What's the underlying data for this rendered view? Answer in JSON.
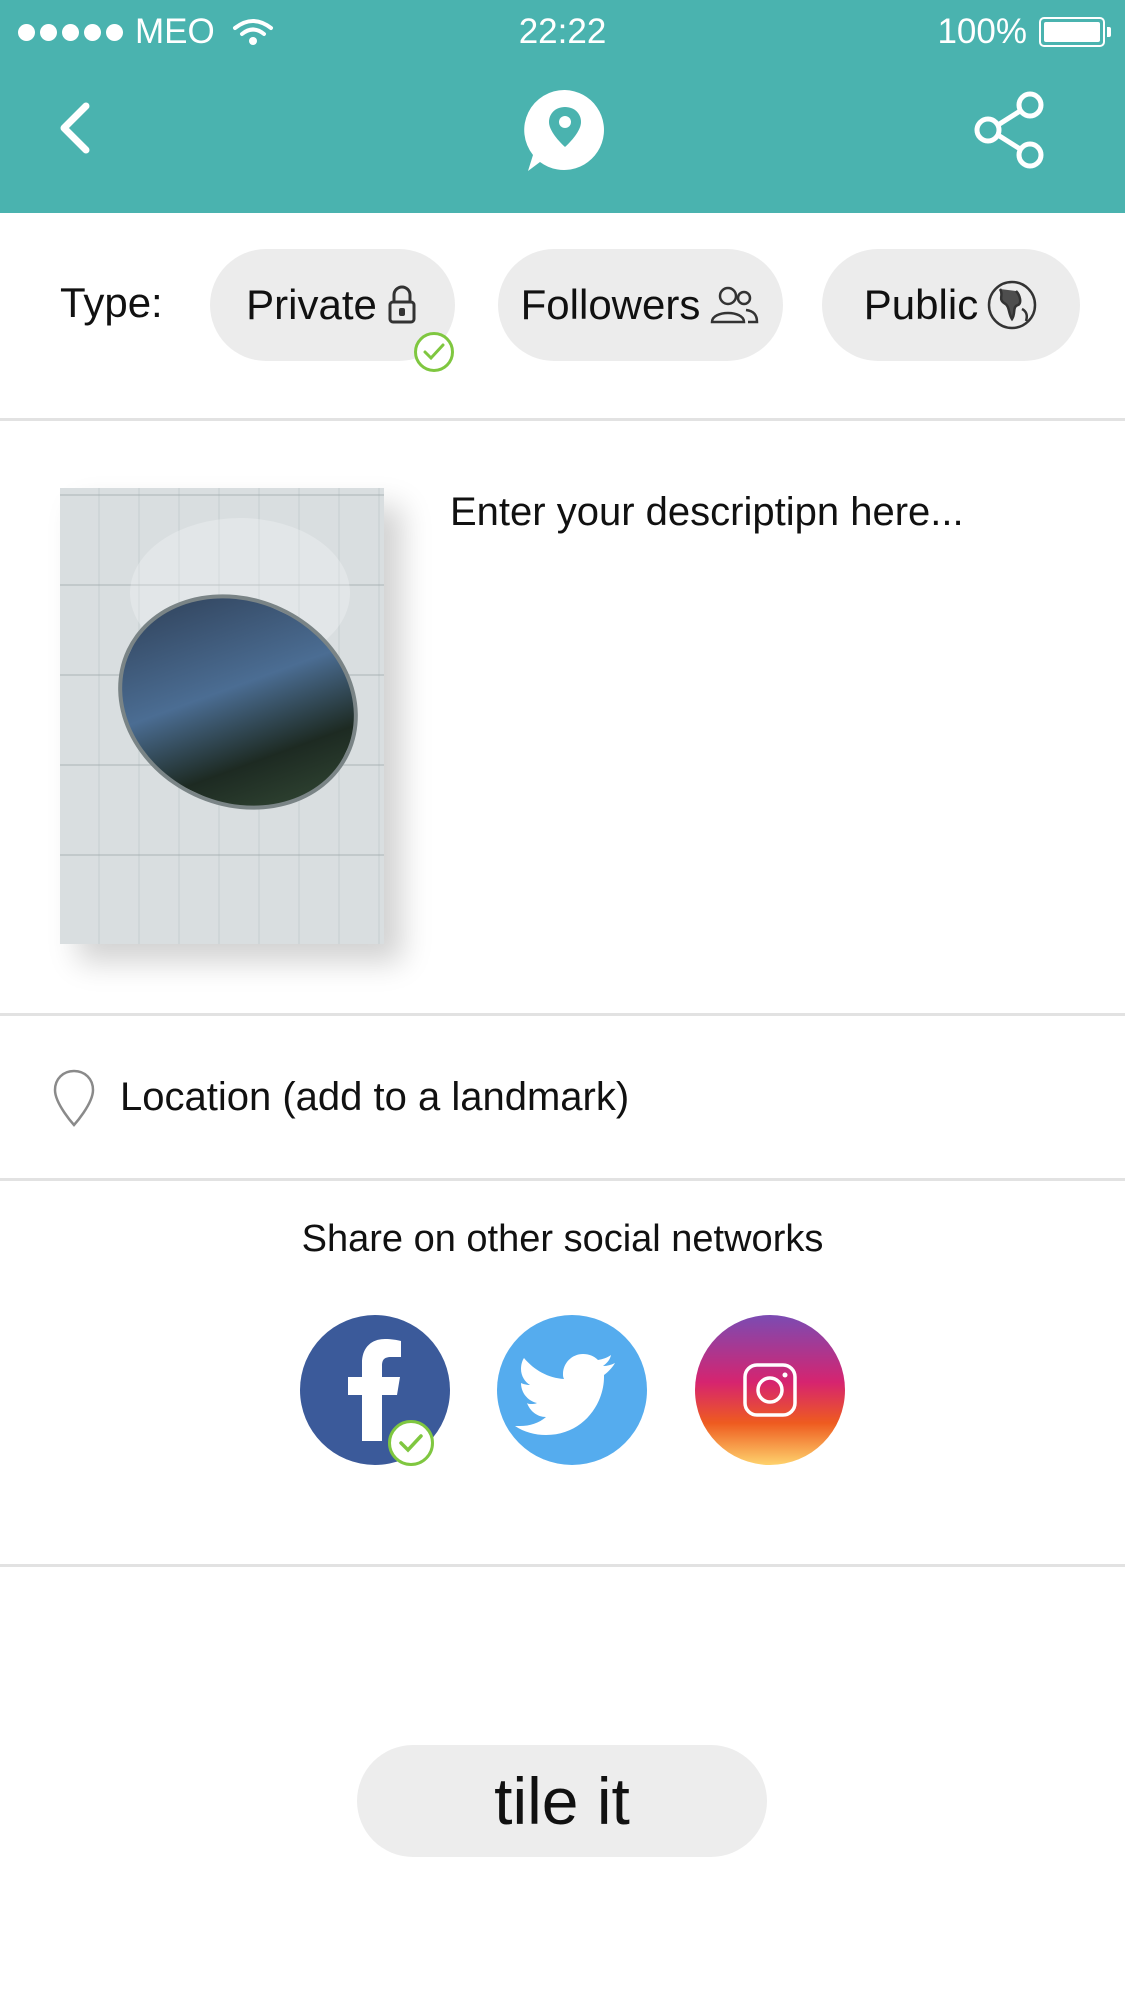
{
  "status_bar": {
    "carrier": "MEO",
    "time": "22:22",
    "battery": "100%"
  },
  "nav": {
    "back_icon": "chevron-left-icon",
    "logo_icon": "map-pin-bubble-icon",
    "share_icon": "share-icon"
  },
  "type": {
    "label": "Type:",
    "options": [
      {
        "label": "Private",
        "icon": "lock-icon",
        "selected": true
      },
      {
        "label": "Followers",
        "icon": "users-icon",
        "selected": false
      },
      {
        "label": "Public",
        "icon": "globe-icon",
        "selected": false
      }
    ]
  },
  "description": {
    "placeholder": "Enter your descriptipn here..."
  },
  "location": {
    "label": "Location (add to a landmark)"
  },
  "share": {
    "title": "Share on other social networks",
    "networks": [
      {
        "name": "facebook",
        "selected": true
      },
      {
        "name": "twitter",
        "selected": false
      },
      {
        "name": "instagram",
        "selected": false
      }
    ]
  },
  "submit": {
    "label": "tile it"
  },
  "colors": {
    "header": "#4ab3af",
    "check": "#7fc740",
    "facebook": "#3b5a9a",
    "twitter": "#55acee"
  }
}
